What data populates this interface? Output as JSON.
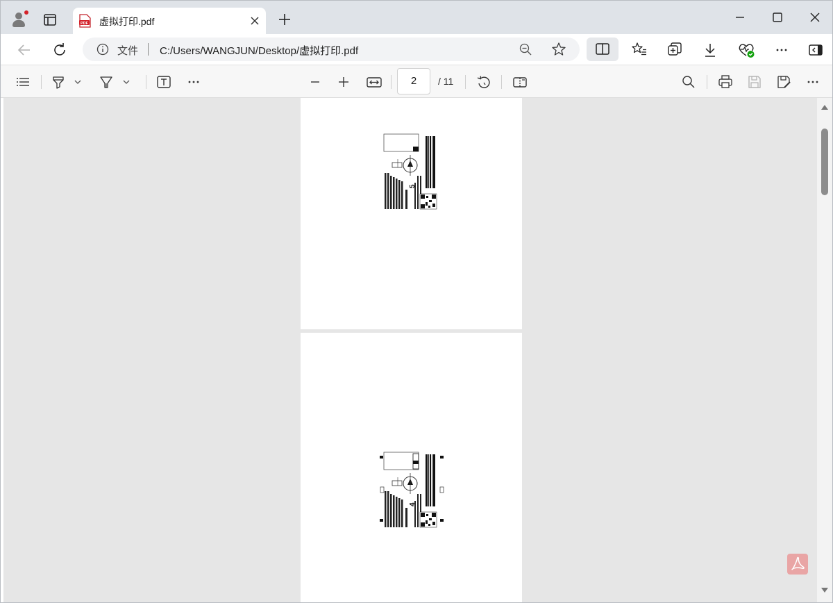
{
  "browser": {
    "tab": {
      "title": "虚拟打印.pdf",
      "favicon_text": "PDF"
    },
    "new_tab_label": "+",
    "window_controls": [
      "minimize-icon",
      "maximize-icon",
      "close-icon"
    ]
  },
  "address_bar": {
    "scheme_label": "文件",
    "url": "C:/Users/WANGJUN/Desktop/虚拟打印.pdf"
  },
  "pdf_toolbar": {
    "current_page": "2",
    "total_pages": "/ 11"
  },
  "pages": [
    {
      "label_number": "5"
    },
    {
      "label_number": "4"
    }
  ],
  "colors": {
    "accent_red": "#d4222a",
    "chrome_bg": "#dfe3e8",
    "viewer_bg": "#e6e6e6"
  }
}
